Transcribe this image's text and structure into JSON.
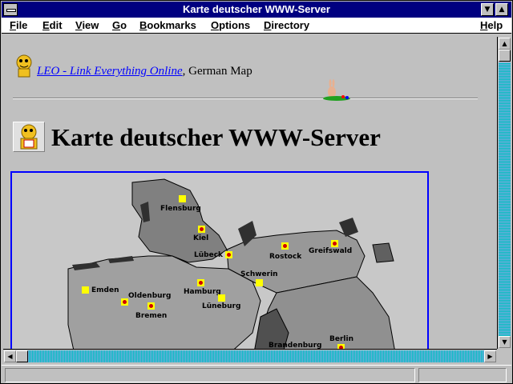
{
  "window": {
    "title": "Karte deutscher WWW-Server"
  },
  "menu": [
    {
      "label": "File",
      "key": "F"
    },
    {
      "label": "Edit",
      "key": "E"
    },
    {
      "label": "View",
      "key": "V"
    },
    {
      "label": "Go",
      "key": "G"
    },
    {
      "label": "Bookmarks",
      "key": "B"
    },
    {
      "label": "Options",
      "key": "O"
    },
    {
      "label": "Directory",
      "key": "D"
    },
    {
      "label": "Help",
      "key": "H"
    }
  ],
  "page": {
    "link_text": "LEO - Link Everything Online",
    "link_suffix": ", German Map",
    "heading": "Karte deutscher WWW-Server"
  },
  "map": {
    "cities": [
      {
        "name": "Flensburg",
        "marker": "plain"
      },
      {
        "name": "Kiel",
        "marker": "dot"
      },
      {
        "name": "Lübeck",
        "marker": "dot"
      },
      {
        "name": "Rostock",
        "marker": "dot"
      },
      {
        "name": "Greifswald",
        "marker": "dot"
      },
      {
        "name": "Schwerin",
        "marker": "plain"
      },
      {
        "name": "Emden",
        "marker": "plain"
      },
      {
        "name": "Oldenburg",
        "marker": "dot"
      },
      {
        "name": "Bremen",
        "marker": "dot"
      },
      {
        "name": "Hamburg",
        "marker": "dot"
      },
      {
        "name": "Lüneburg",
        "marker": "plain"
      },
      {
        "name": "Brandenburg",
        "marker": "none"
      },
      {
        "name": "Berlin",
        "marker": "dot"
      }
    ]
  },
  "icons": {
    "leo_logo": "leo-lion-icon",
    "bunny": "bunny-icon"
  },
  "colors": {
    "titlebar": "#000080",
    "link": "#0000ff",
    "map_border": "#0000ff",
    "marker": "#ffff00",
    "marker_dot": "#d00000"
  }
}
